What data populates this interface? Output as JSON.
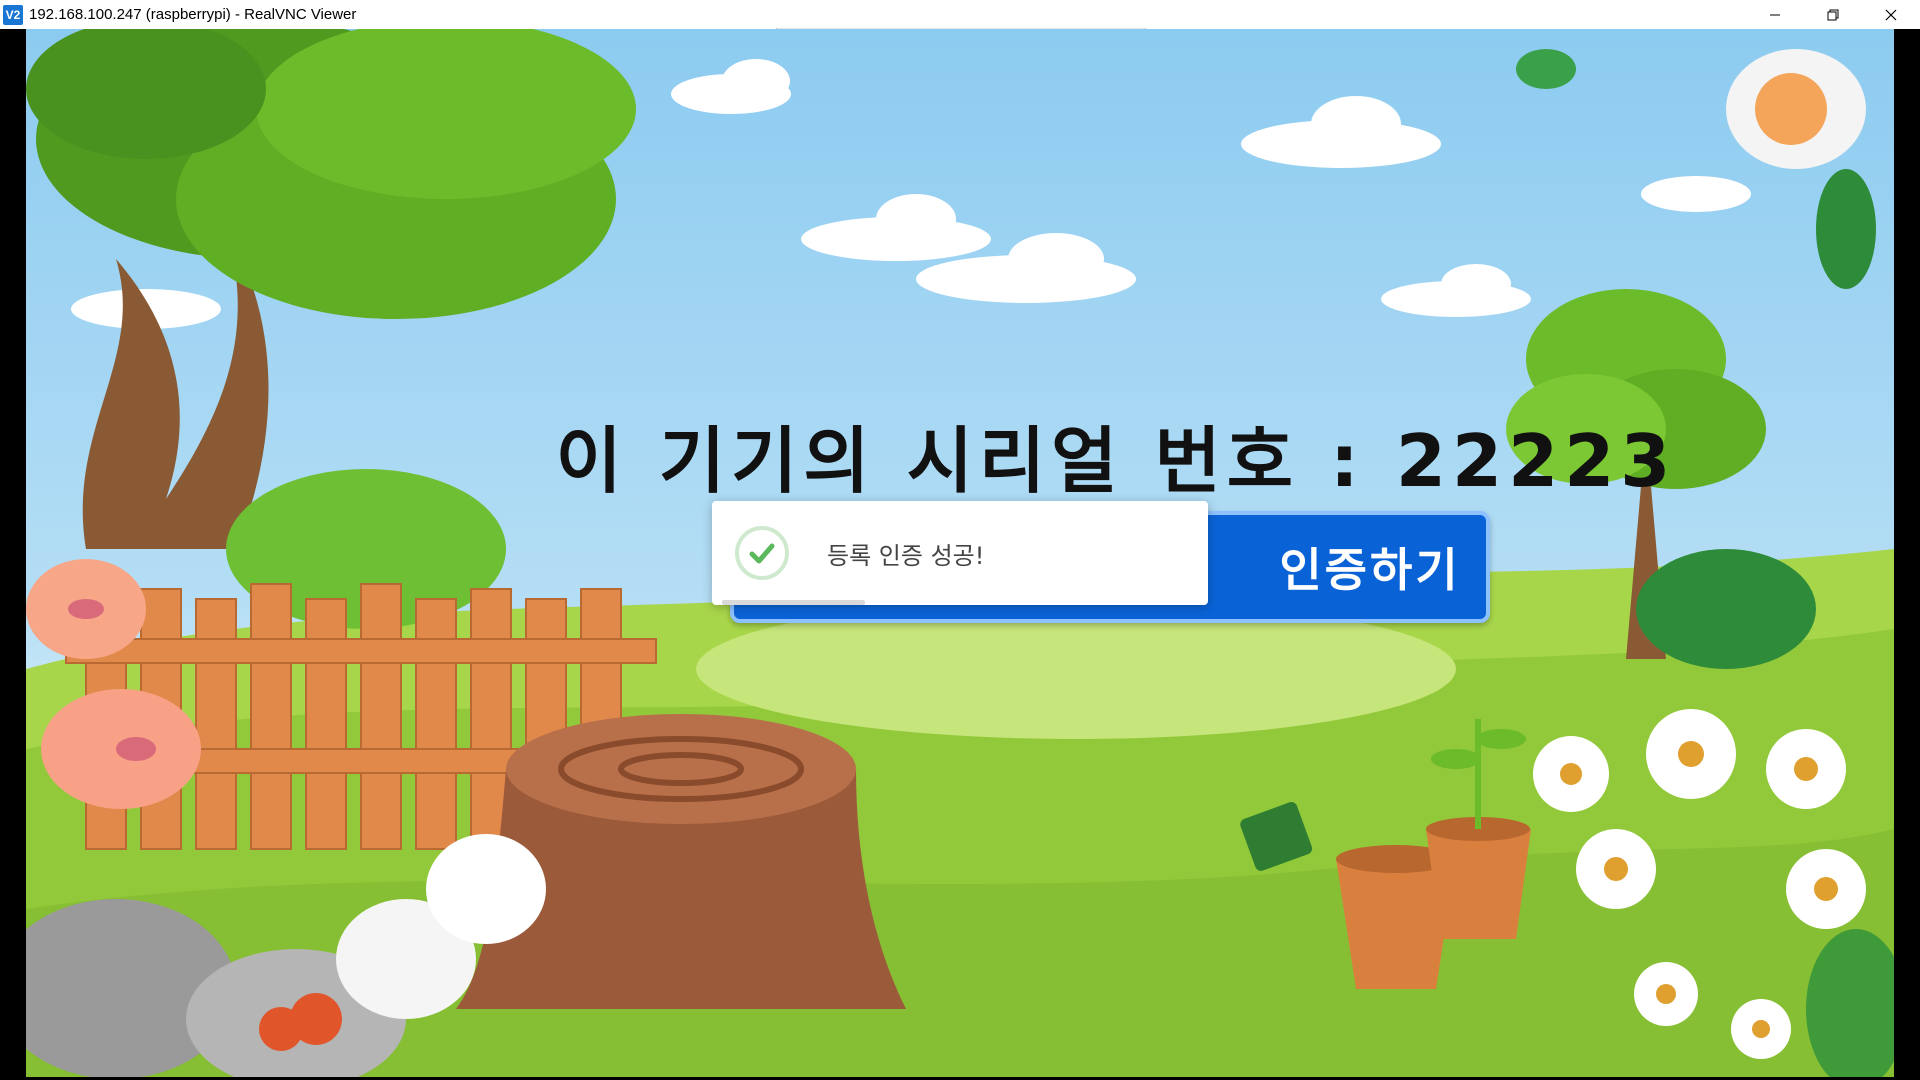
{
  "window": {
    "title": "192.168.100.247 (raspberrypi) - RealVNC Viewer",
    "app_icon_glyph": "V2",
    "controls": {
      "minimize_icon": "minimize-icon",
      "restore_icon": "restore-icon",
      "close_icon": "close-icon"
    }
  },
  "app": {
    "serial_heading": "이 기기의 시리얼 번호 : 22223",
    "auth_button_label": "인증하기"
  },
  "toast": {
    "message": "등록 인증 성공!",
    "icon": "check-circle-icon",
    "accent_color": "#5cb85c",
    "progress_remaining": 0.3
  },
  "colors": {
    "sky": "#8ccbf0",
    "grass": "#9ccf3e",
    "button": "#0a63d6"
  }
}
